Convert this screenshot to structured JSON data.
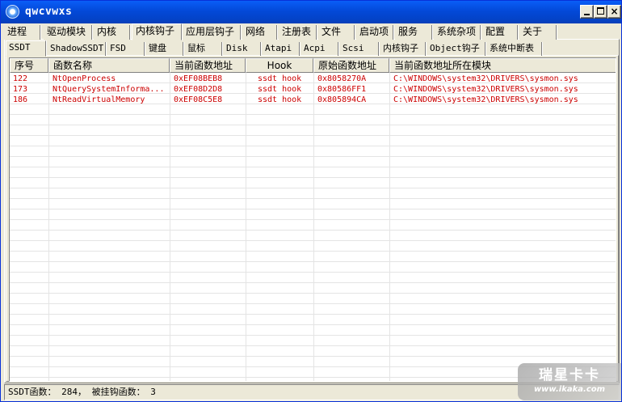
{
  "window": {
    "title": "qwcvwxs"
  },
  "main_tabs": [
    "进程",
    "驱动模块",
    "内核",
    "内核钩子",
    "应用层钩子",
    "网络",
    "注册表",
    "文件",
    "启动项",
    "服务",
    "系统杂项",
    "配置",
    "关于"
  ],
  "main_tab_active": "内核钩子",
  "sub_tabs": [
    "SSDT",
    "ShadowSSDT",
    "FSD",
    "键盘",
    "鼠标",
    "Disk",
    "Atapi",
    "Acpi",
    "Scsi",
    "内核钩子",
    "Object钩子",
    "系统中断表"
  ],
  "sub_tab_active": "SSDT",
  "table": {
    "columns": [
      "序号",
      "函数名称",
      "当前函数地址",
      "Hook",
      "原始函数地址",
      "当前函数地址所在模块"
    ],
    "rows": [
      [
        "122",
        "NtOpenProcess",
        "0xEF08BEB8",
        "ssdt hook",
        "0x8058270A",
        "C:\\WINDOWS\\system32\\DRIVERS\\sysmon.sys"
      ],
      [
        "173",
        "NtQuerySystemInforma...",
        "0xEF08D2D8",
        "ssdt hook",
        "0x80586FF1",
        "C:\\WINDOWS\\system32\\DRIVERS\\sysmon.sys"
      ],
      [
        "186",
        "NtReadVirtualMemory",
        "0xEF08C5E8",
        "ssdt hook",
        "0x805894CA",
        "C:\\WINDOWS\\system32\\DRIVERS\\sysmon.sys"
      ]
    ],
    "hook_row_color": "#cc0000"
  },
  "status": {
    "text": "SSDT函数： 284， 被挂钩函数： 3"
  },
  "watermark": {
    "name": "瑞星卡卡",
    "url": "www.ikaka.com"
  }
}
